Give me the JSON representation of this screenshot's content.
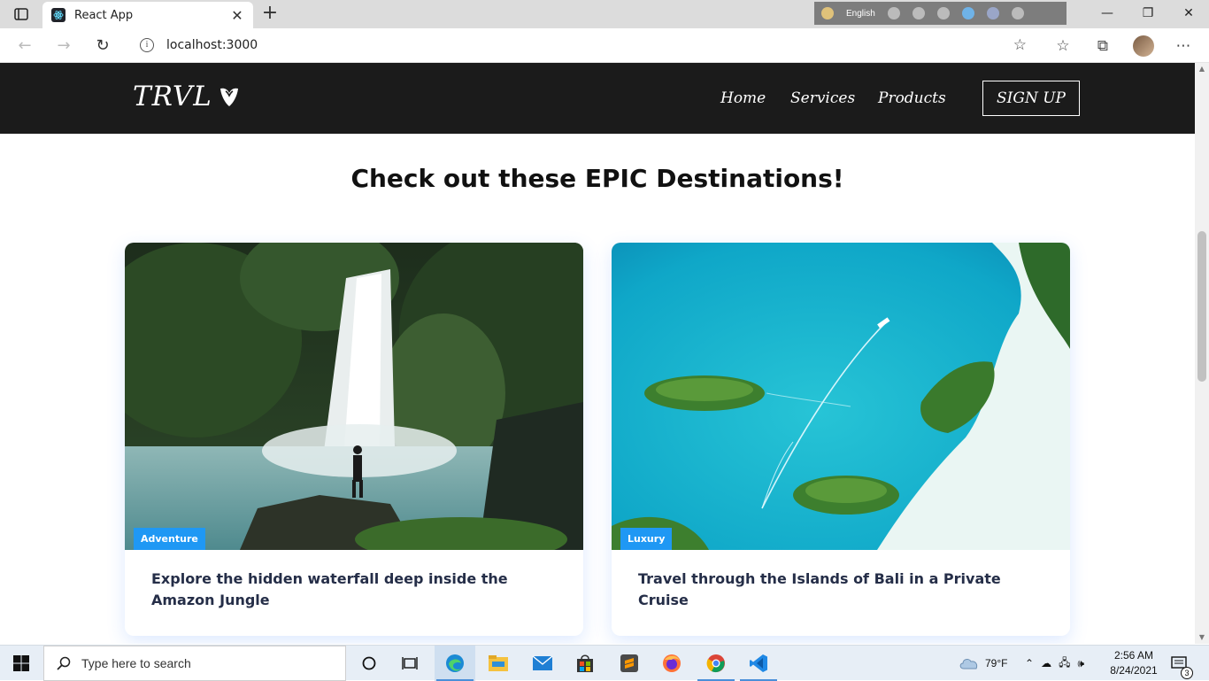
{
  "browser": {
    "tab_title": "React App",
    "new_tab": "+",
    "url": "localhost:3000",
    "ime_language": "English"
  },
  "site": {
    "logo_text": "TRVL",
    "nav": [
      "Home",
      "Services",
      "Products"
    ],
    "signup_label": "SIGN UP",
    "heading": "Check out these EPIC Destinations!",
    "cards": [
      {
        "badge": "Adventure",
        "text": "Explore the hidden waterfall deep inside the Amazon Jungle"
      },
      {
        "badge": "Luxury",
        "text": "Travel through the Islands of Bali in a Private Cruise"
      }
    ]
  },
  "taskbar": {
    "search_placeholder": "Type here to search",
    "weather": "79°F",
    "time": "2:56 AM",
    "date": "8/24/2021",
    "notifications": "3"
  },
  "colors": {
    "navbar_bg": "#1b1b1b",
    "badge_bg": "#1f98f4",
    "card_text": "#252e48"
  }
}
